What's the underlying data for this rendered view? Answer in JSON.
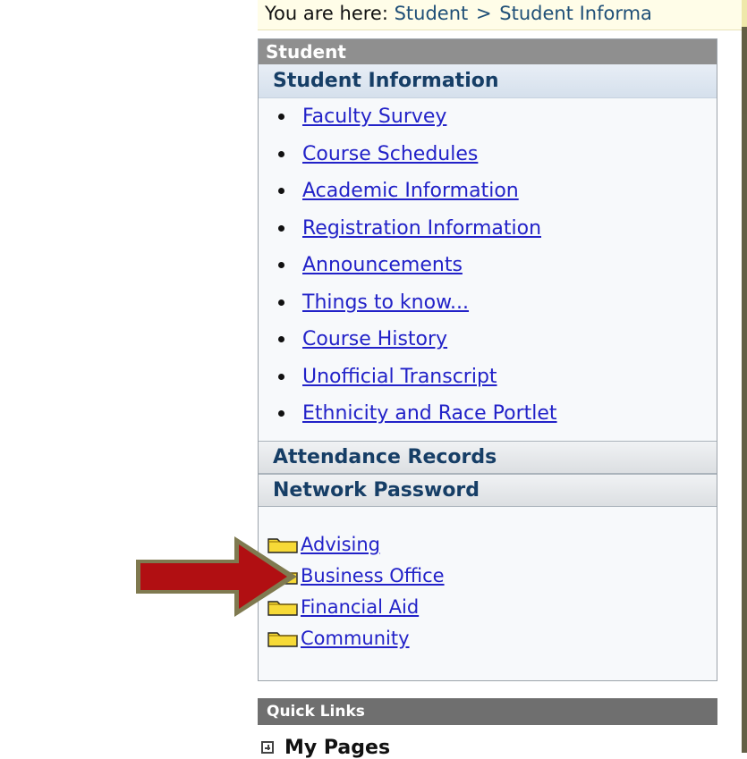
{
  "top_text": "",
  "breadcrumb": {
    "prefix": "You are here:",
    "items": [
      "Student",
      "Student Informa"
    ],
    "separator": ">"
  },
  "panel": {
    "student_header": "Student",
    "student_information_header": "Student Information",
    "links": [
      "Faculty Survey",
      "Course Schedules",
      "Academic Information",
      "Registration Information",
      "Announcements",
      "Things to know...",
      "Course History",
      "Unofficial Transcript",
      "Ethnicity and Race Portlet"
    ],
    "attendance_header": "Attendance Records",
    "network_header": "Network Password",
    "folders": [
      "Advising",
      "Business Office",
      "Financial Aid",
      "Community"
    ]
  },
  "quick_links": {
    "title": "Quick Links",
    "my_pages": "My Pages"
  },
  "colors": {
    "arrow_fill": "#b10f12",
    "arrow_outline": "#7f7a50",
    "link": "#2222c8",
    "header_dark": "#8f8f8f",
    "quick_links_bg": "#6f6f6f"
  }
}
